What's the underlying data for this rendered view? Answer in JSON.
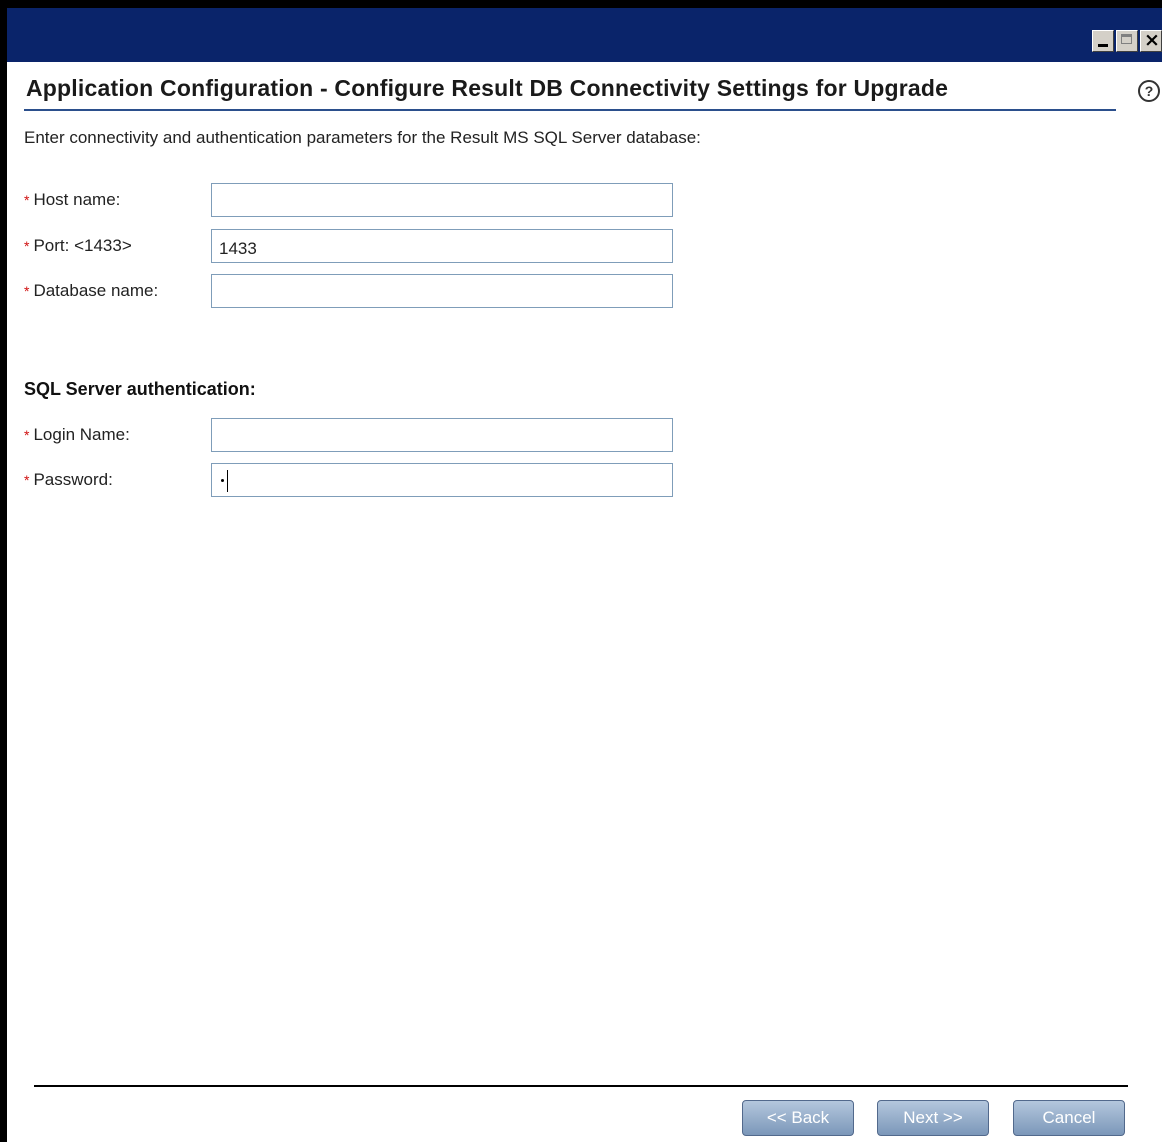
{
  "window": {
    "title": "",
    "controls": [
      "minimize-icon",
      "maximize-icon",
      "close-icon"
    ]
  },
  "page": {
    "title": "Application Configuration - Configure Result DB Connectivity Settings for Upgrade",
    "help_icon": "question-mark-icon",
    "subtitle": "Enter connectivity and authentication parameters for the Result MS SQL Server database:"
  },
  "connection": {
    "host_label": "Host name:",
    "host_value": "",
    "port_label": "Port: <1433>",
    "port_value": "1433",
    "db_label": "Database name:",
    "db_value": ""
  },
  "auth": {
    "heading": "SQL Server authentication:",
    "login_label": "Login Name:",
    "login_value": "",
    "password_label": "Password:",
    "password_masked_chars": 1
  },
  "required_marker": "*",
  "buttons": {
    "back": "<< Back",
    "next": "Next >>",
    "cancel": "Cancel"
  },
  "colors": {
    "titlebar": "#0a246a",
    "required": "#d01010",
    "button_top": "#b4c7dd",
    "button_bottom": "#7b97b9"
  }
}
